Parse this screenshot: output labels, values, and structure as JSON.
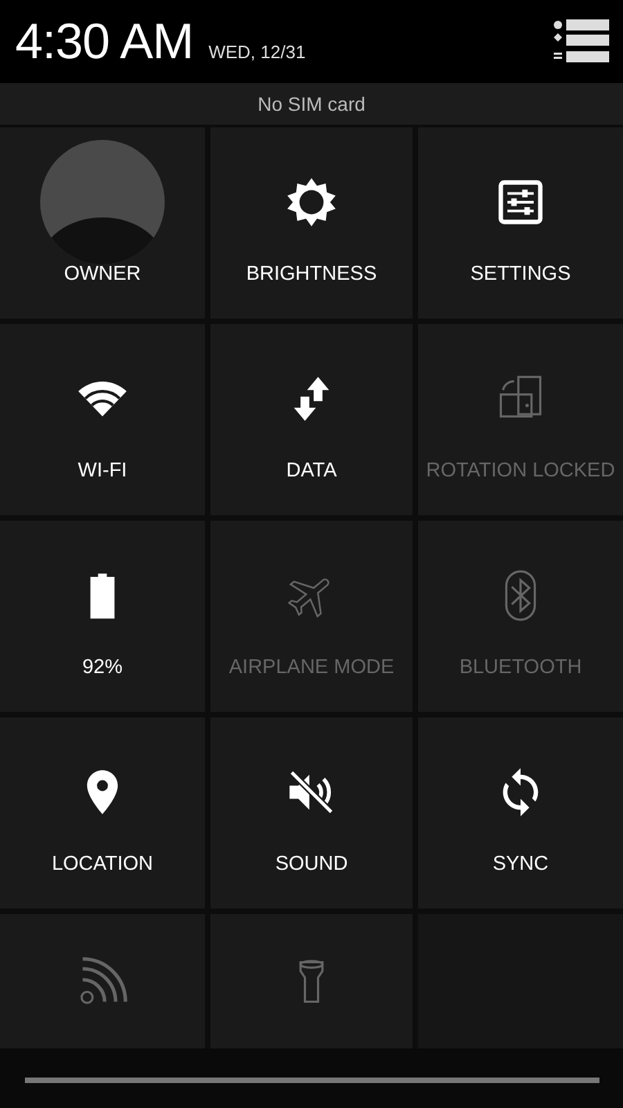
{
  "header": {
    "time": "4:30 AM",
    "date": "WED, 12/31"
  },
  "status": {
    "text": "No SIM card"
  },
  "tiles": [
    {
      "kind": "avatar",
      "label": "OWNER",
      "on": true
    },
    {
      "kind": "brightness",
      "label": "BRIGHTNESS",
      "on": true
    },
    {
      "kind": "settings",
      "label": "SETTINGS",
      "on": true
    },
    {
      "kind": "wifi",
      "label": "WI-FI",
      "on": true
    },
    {
      "kind": "data",
      "label": "DATA",
      "on": true
    },
    {
      "kind": "rotation",
      "label": "ROTATION LOCKED",
      "on": false
    },
    {
      "kind": "battery",
      "label": "92%",
      "on": true
    },
    {
      "kind": "airplane",
      "label": "AIRPLANE MODE",
      "on": false
    },
    {
      "kind": "bluetooth",
      "label": "BLUETOOTH",
      "on": false
    },
    {
      "kind": "location",
      "label": "LOCATION",
      "on": true
    },
    {
      "kind": "sound",
      "label": "SOUND",
      "on": true
    },
    {
      "kind": "sync",
      "label": "SYNC",
      "on": true
    },
    {
      "kind": "cast",
      "on": false
    },
    {
      "kind": "flashlight",
      "on": false
    }
  ]
}
